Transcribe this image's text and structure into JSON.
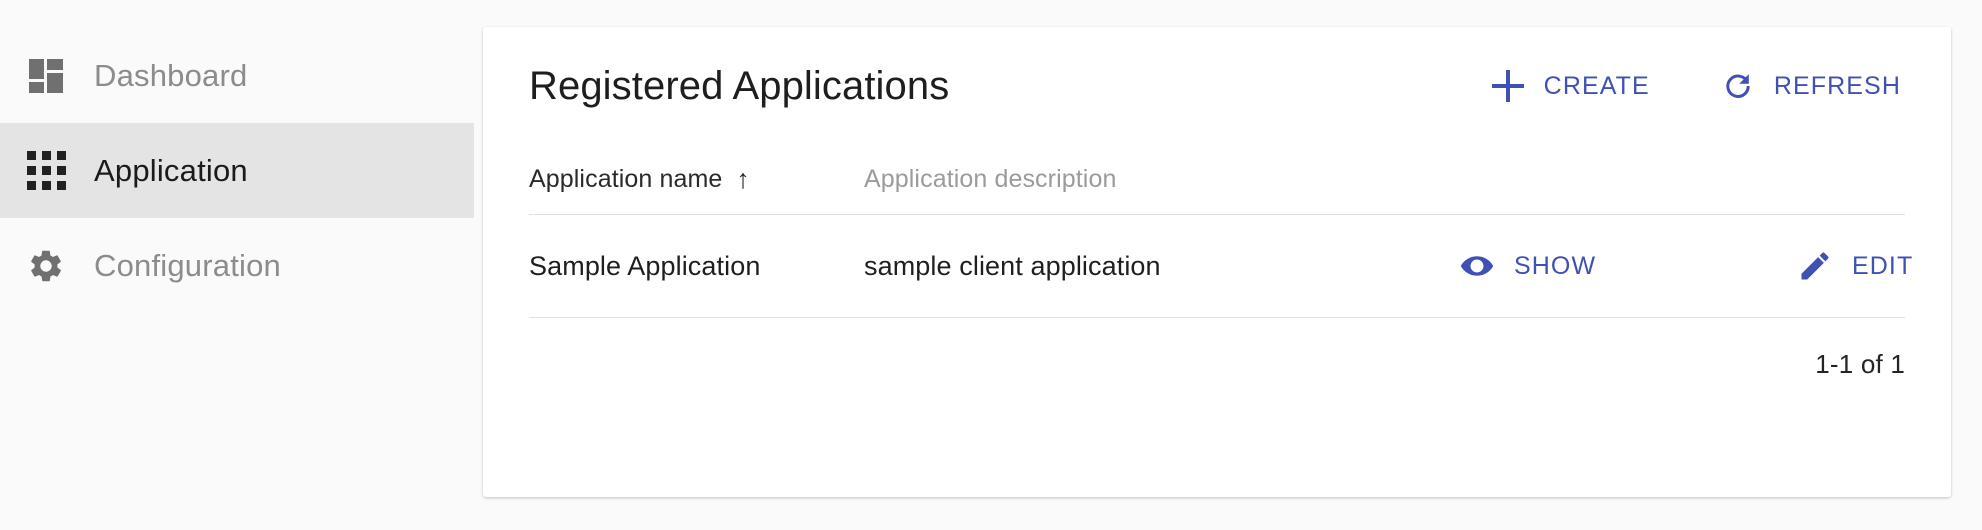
{
  "theme": {
    "accent": "#3f51b5",
    "page_background": "#fafafa",
    "card_background": "#ffffff",
    "active_nav_background": "#e4e4e4",
    "divider": "#e0e0e0",
    "muted_text": "#9b9b9b",
    "primary_text": "#1f1f1f"
  },
  "sidebar": {
    "items": [
      {
        "label": "Dashboard",
        "icon": "dashboard-icon",
        "active": false
      },
      {
        "label": "Application",
        "icon": "apps-grid-icon",
        "active": true
      },
      {
        "label": "Configuration",
        "icon": "gear-icon",
        "active": false
      }
    ]
  },
  "card": {
    "header": {
      "title": "Registered Applications",
      "actions": [
        {
          "label": "CREATE",
          "icon": "plus-icon"
        },
        {
          "label": "REFRESH",
          "icon": "refresh-icon"
        }
      ]
    },
    "table": {
      "columns": [
        {
          "key": "name",
          "label": "Application name",
          "sorted": true,
          "sort_direction": "asc",
          "sort_arrow": "↑"
        },
        {
          "key": "description",
          "label": "Application description",
          "sorted": false
        },
        {
          "key": "show",
          "label": ""
        },
        {
          "key": "edit",
          "label": ""
        }
      ],
      "rows": [
        {
          "name": "Sample Application",
          "description": "sample client application",
          "show_label": "SHOW",
          "show_icon": "eye-icon",
          "edit_label": "EDIT",
          "edit_icon": "pencil-icon"
        }
      ]
    },
    "paginator": {
      "range_label": "1-1 of 1"
    }
  }
}
